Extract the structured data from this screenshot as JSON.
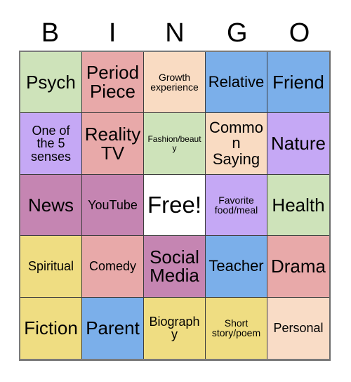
{
  "card": {
    "title": "BINGO Card",
    "header_letters": [
      "B",
      "I",
      "N",
      "G",
      "O"
    ],
    "colors": {
      "green": "#CEE3BA",
      "pink": "#E8A9A9",
      "peach": "#F9DBC2",
      "blue": "#7BAFEA",
      "purple": "#C5A8F5",
      "mauve": "#C585B2",
      "yellow": "#EFDD82",
      "light_peach": "#F9DCC6",
      "free_white": "#FFFFFF",
      "grid_line": "#3D3D3D",
      "grid_border": "#7A7A7A",
      "text": "#000000",
      "background": "#FFFFFF"
    },
    "cells": [
      {
        "label": "Psych",
        "color": "#CEE3BA",
        "size": "size-lg"
      },
      {
        "label": "Period Piece",
        "color": "#E8A9A9",
        "size": "size-lg"
      },
      {
        "label": "Growth experience",
        "color": "#F9DBC2",
        "size": "size-xs"
      },
      {
        "label": "Relative",
        "color": "#7BAFEA",
        "size": "size-md"
      },
      {
        "label": "Friend",
        "color": "#7BAFEA",
        "size": "size-lg"
      },
      {
        "label": "One of the 5 senses",
        "color": "#C5A8F5",
        "size": "size-sm"
      },
      {
        "label": "Reality TV",
        "color": "#E8A9A9",
        "size": "size-lg"
      },
      {
        "label": "Fashion/beauty",
        "color": "#CEE3BA",
        "size": "size-xxs"
      },
      {
        "label": "Common Saying",
        "color": "#F9DBC2",
        "size": "size-md"
      },
      {
        "label": "Nature",
        "color": "#C5A8F5",
        "size": "size-lg"
      },
      {
        "label": "News",
        "color": "#C585B2",
        "size": "size-lg"
      },
      {
        "label": "YouTube",
        "color": "#C585B2",
        "size": "size-sm"
      },
      {
        "label": "Free!",
        "color": "#FFFFFF",
        "size": "size-xl"
      },
      {
        "label": "Favorite food/meal",
        "color": "#C5A8F5",
        "size": "size-xs"
      },
      {
        "label": "Health",
        "color": "#CEE3BA",
        "size": "size-lg"
      },
      {
        "label": "Spiritual",
        "color": "#EFDD82",
        "size": "size-sm"
      },
      {
        "label": "Comedy",
        "color": "#E8A9A9",
        "size": "size-sm"
      },
      {
        "label": "Social Media",
        "color": "#C585B2",
        "size": "size-lg"
      },
      {
        "label": "Teacher",
        "color": "#7BAFEA",
        "size": "size-md"
      },
      {
        "label": "Drama",
        "color": "#E8A9A9",
        "size": "size-lg"
      },
      {
        "label": "Fiction",
        "color": "#EFDD82",
        "size": "size-lg"
      },
      {
        "label": "Parent",
        "color": "#7BAFEA",
        "size": "size-lg"
      },
      {
        "label": "Biography",
        "color": "#EFDD82",
        "size": "size-sm"
      },
      {
        "label": "Short story/poem",
        "color": "#EFDD82",
        "size": "size-xs"
      },
      {
        "label": "Personal",
        "color": "#F9DCC6",
        "size": "size-sm"
      }
    ]
  }
}
